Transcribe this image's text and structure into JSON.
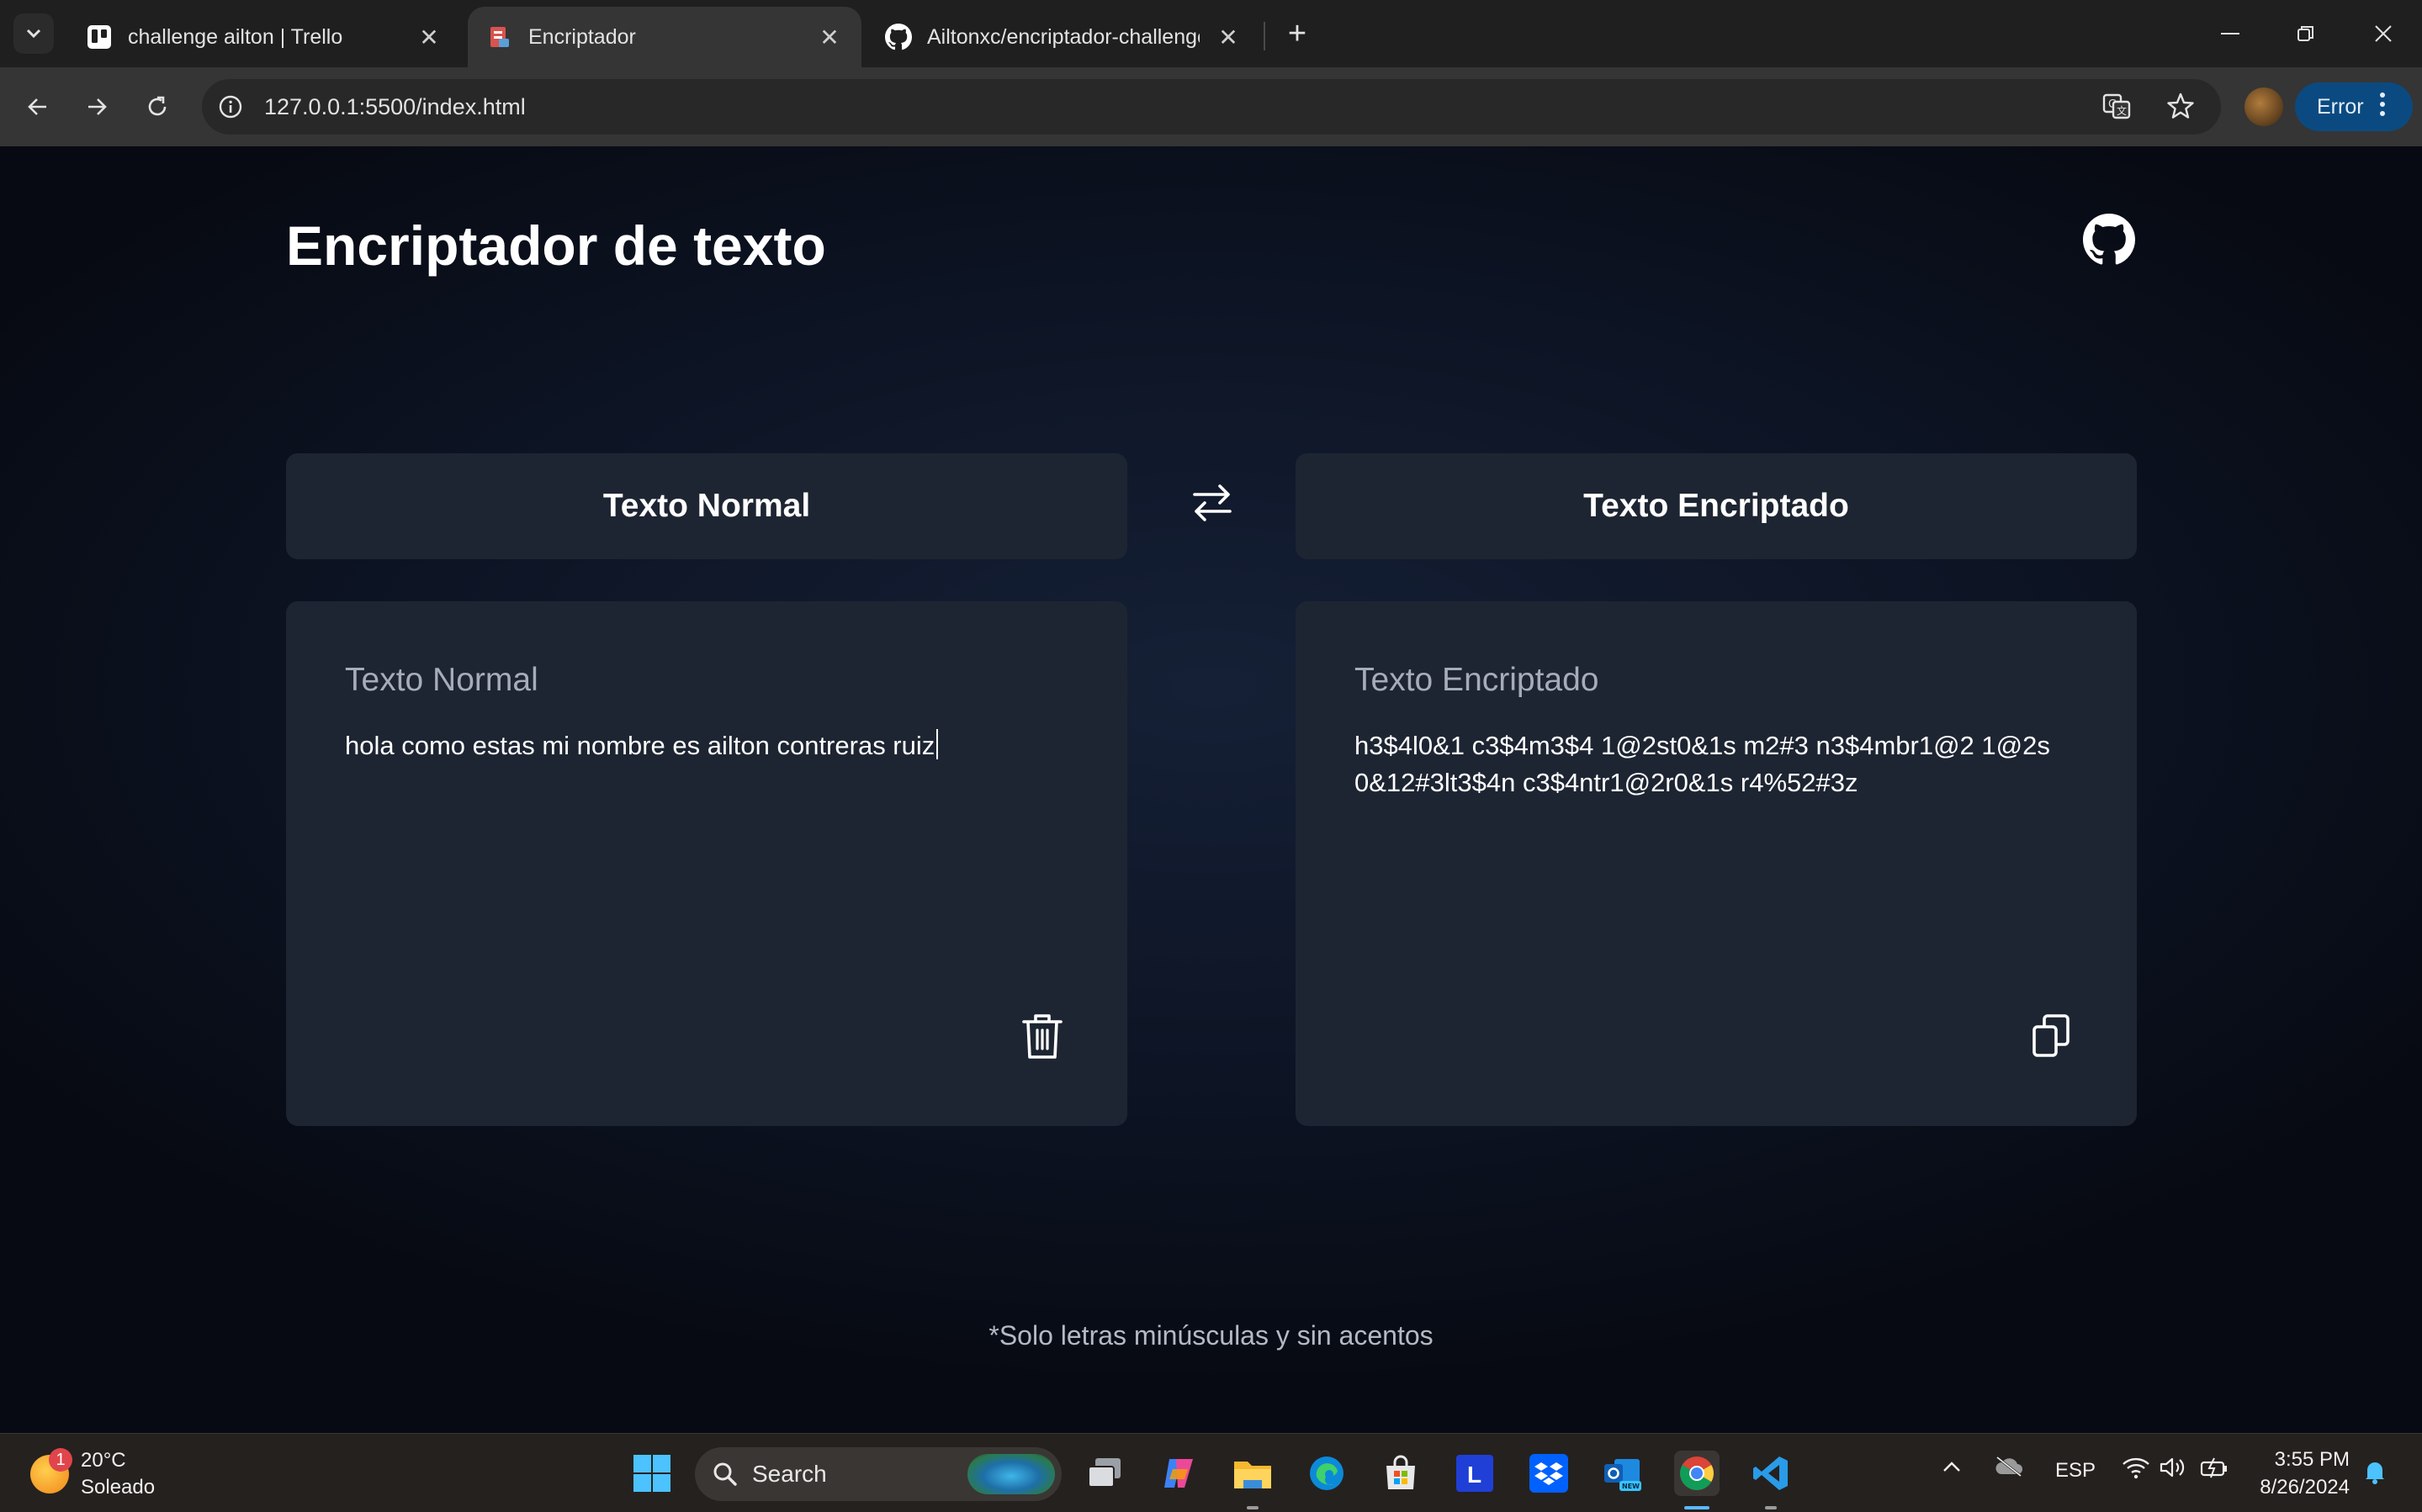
{
  "browser": {
    "tabs": [
      {
        "title": "challenge ailton | Trello",
        "favicon": "trello-icon",
        "active": false
      },
      {
        "title": "Encriptador",
        "favicon": "page-icon",
        "active": true
      },
      {
        "title": "Ailtonxc/encriptador-challenge",
        "favicon": "github-icon",
        "active": false
      }
    ],
    "url": "127.0.0.1:5500/index.html",
    "profile_status": "Error"
  },
  "page": {
    "title": "Encriptador de texto",
    "left_header": "Texto Normal",
    "right_header": "Texto Encriptado",
    "input_label": "Texto Normal",
    "input_value": "hola como estas mi nombre es ailton contreras ruiz",
    "output_label": "Texto Encriptado",
    "output_value": "h3$4l0&1 c3$4m3$4 1@2st0&1s m2#3 n3$4mbr1@2 1@2s 0&12#3lt3$4n c3$4ntr1@2r0&1s r4%52#3z",
    "footnote": "*Solo letras minúsculas y sin acentos"
  },
  "taskbar": {
    "weather_temp": "20°C",
    "weather_desc": "Soleado",
    "weather_badge": "1",
    "search_label": "Search",
    "language": "ESP",
    "time": "3:55 PM",
    "date": "8/26/2024"
  }
}
